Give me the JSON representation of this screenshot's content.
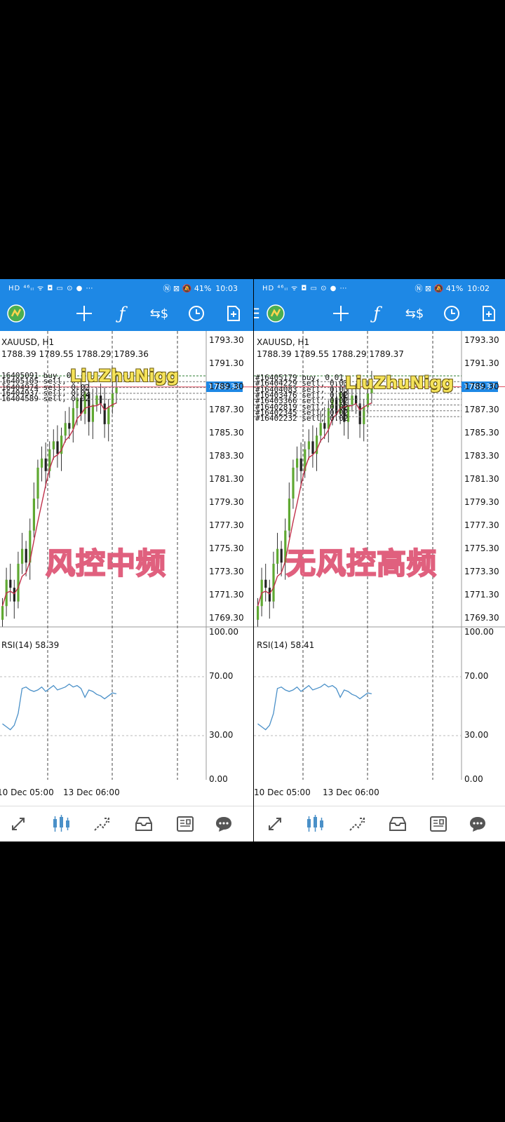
{
  "left": {
    "status": {
      "left_icons": "HD ⁴⁶ᵢₗ ᯤ ◘ ▭ ⊙ ● ⋯",
      "right_icons": "Ⓝ ⊠ 🔕 41%",
      "time": "10:03"
    },
    "symbol": "XAUUSD, H1",
    "ohlc": "1788.39 1789.55 1788.29 1789.36",
    "orders": [
      "16405091 buy, 0.",
      "16405105 sell, 0.",
      "16404974 sell, 0.02",
      "16404937 sell, 0.02",
      "16404589 sell, 0.02"
    ],
    "watermark": "LiuZhuNigg",
    "overlay": "风控中频",
    "current_price": "1789.36",
    "price_ticks": [
      "1793.30",
      "1791.30",
      "1789.30",
      "1787.30",
      "1785.30",
      "1783.30",
      "1781.30",
      "1779.30",
      "1777.30",
      "1775.30",
      "1773.30",
      "1771.30",
      "1769.30"
    ],
    "rsi_label": "RSI(14) 58.39",
    "rsi_ticks": [
      "100.00",
      "70.00",
      "30.00",
      "0.00"
    ],
    "dates": [
      "10 Dec 05:00",
      "13 Dec 06:00"
    ]
  },
  "right": {
    "status": {
      "left_icons": "HD ⁴⁶ᵢₗ ᯤ ◘ ▭ ⊙ ● ⋯",
      "right_icons": "Ⓝ ⊠ 🔕 41%",
      "time": "10:02"
    },
    "symbol": "XAUUSD, H1",
    "ohlc": "1788.39 1789.55 1788.29 1789.37",
    "orders": [
      "#16405179 buy, 0.01",
      "#16404229 sell, 0.03",
      "#16404083 sell, 0.03",
      "#16403476 sell, 0.02",
      "#16403366 sell, 0.02",
      "#16402819 sell, 0.02",
      "#16402345 sell, 0.02",
      "#16402232 sell, 0.02"
    ],
    "watermark": "LiuZhuNigg",
    "overlay": "无风控高频",
    "current_price": "1789.37",
    "price_ticks": [
      "1793.30",
      "1791.30",
      "1789.30",
      "1787.30",
      "1785.30",
      "1783.30",
      "1781.30",
      "1779.30",
      "1777.30",
      "1775.30",
      "1773.30",
      "1771.30",
      "1769.30"
    ],
    "rsi_label": "RSI(14) 58.41",
    "rsi_ticks": [
      "100.00",
      "70.00",
      "30.00",
      "0.00"
    ],
    "dates": [
      "10 Dec 05:00",
      "13 Dec 06:00"
    ]
  },
  "toolbar_icons": [
    "app-logo-icon",
    "crosshair-icon",
    "indicators-icon",
    "symbols-icon",
    "period-icon",
    "new-order-icon"
  ],
  "nav_icons": [
    "quotes-icon",
    "chart-icon",
    "trade-icon",
    "history-icon",
    "news-icon",
    "messages-icon"
  ],
  "colors": {
    "accent": "#1e88e5",
    "bull": "#5fa832",
    "bear": "#222222",
    "ma": "#c0304a",
    "rsi": "#4a90c8",
    "price_line": "#e05060"
  },
  "chart_data": {
    "type": "candlestick",
    "series_price": [
      1770.2,
      1772.5,
      1771.8,
      1770.6,
      1773.9,
      1775.2,
      1774.0,
      1776.8,
      1779.6,
      1782.3,
      1783.1,
      1782.0,
      1783.9,
      1784.6,
      1783.5,
      1785.1,
      1786.2,
      1785.7,
      1787.5,
      1788.4,
      1787.0,
      1788.9,
      1786.3,
      1787.8,
      1788.6,
      1787.9,
      1786.1,
      1787.6,
      1788.8,
      1789.36
    ],
    "rsi": [
      38,
      36,
      34,
      37,
      45,
      62,
      63,
      61,
      60,
      61,
      63,
      60,
      62,
      64,
      61,
      62,
      63,
      65,
      63,
      64,
      62,
      56,
      61,
      60,
      58,
      57,
      55,
      57,
      59,
      58.4
    ],
    "ylim": [
      1768.5,
      1794.0
    ],
    "rsi_lim": [
      0,
      100
    ]
  }
}
